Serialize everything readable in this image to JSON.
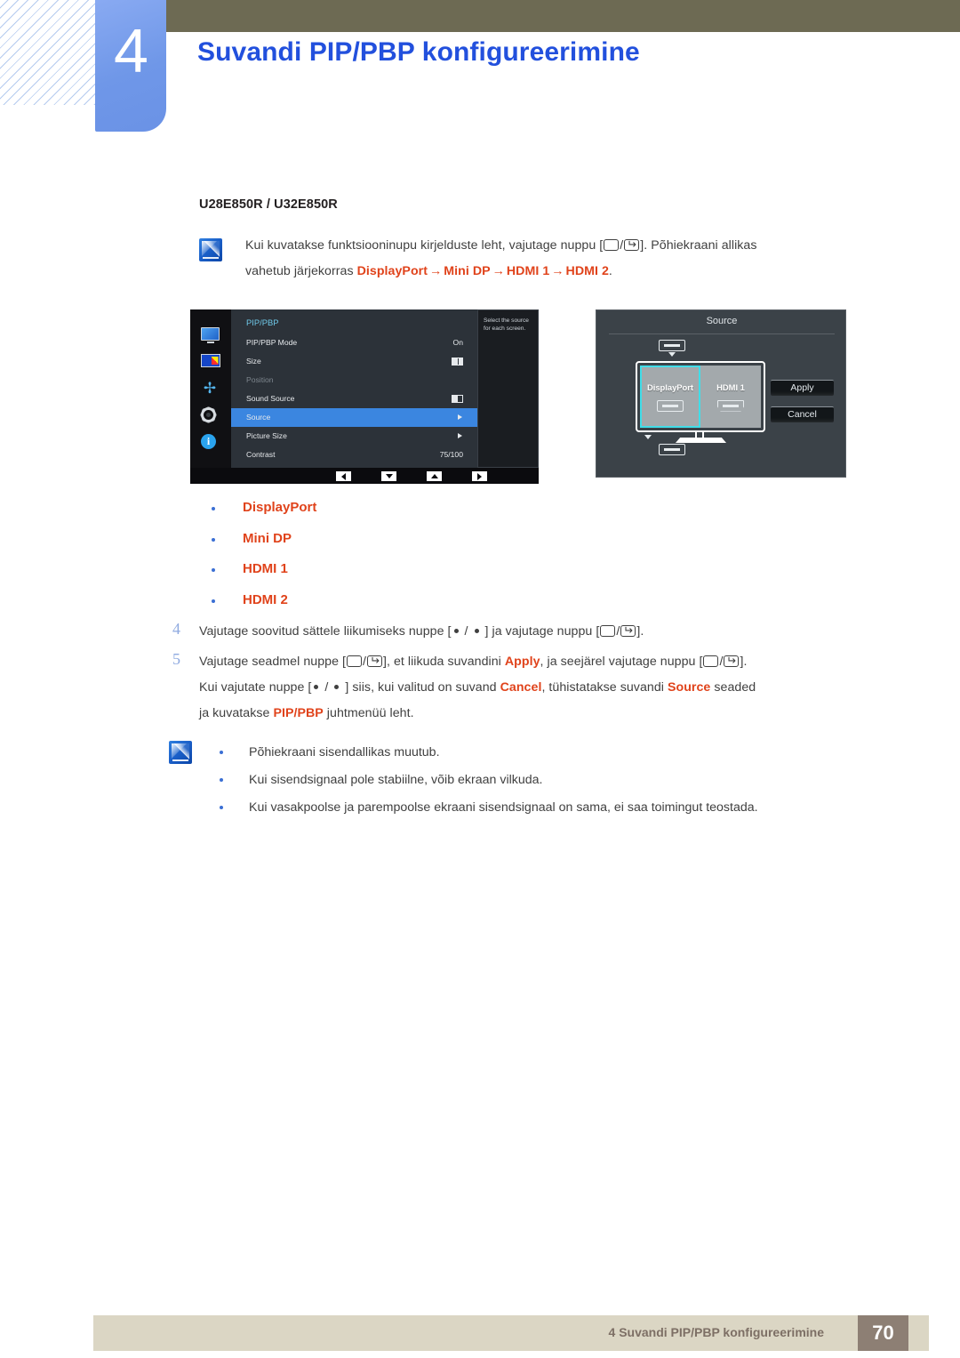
{
  "header": {
    "chapter_number": "4",
    "chapter_title": "Suvandi PIP/PBP konfigureerimine",
    "accent_color": "#2250dd",
    "tab_color": "#6f97e8",
    "olive_color": "#6d6a53"
  },
  "body": {
    "model_heading": "U28E850R / U32E850R",
    "note_intro": {
      "line1_before": "Kui kuvatakse funktsiooninupu kirjelduste leht, vajutage nuppu [",
      "line1_after": "]. Põhiekraani allikas",
      "line2_prefix": "vahetub järjekorras ",
      "line2_items": [
        "DisplayPort",
        "Mini DP",
        "HDMI 1",
        "HDMI 2"
      ],
      "line2_suffix": ".",
      "arrow": "→"
    },
    "source_list": [
      "DisplayPort",
      "Mini DP",
      "HDMI 1",
      "HDMI 2"
    ],
    "steps": [
      {
        "number": "4",
        "parts": [
          "Vajutage soovitud sättele liikumiseks nuppe [",
          " / ",
          " ] ja vajutage nuppu [",
          "]."
        ]
      },
      {
        "number": "5",
        "line1_a": "Vajutage seadmel nuppe [",
        "line1_b": "], et liikuda suvandini ",
        "line1_hl": "Apply",
        "line1_c": ", ja seejärel vajutage nuppu [",
        "line1_d": "].",
        "line2_a": "Kui vajutate nuppe [",
        "line2_b": " ] siis, kui valitud on suvand ",
        "line2_hl1": "Cancel",
        "line2_c": ", tühistatakse suvandi ",
        "line2_hl2": "Source",
        "line2_d": " seaded",
        "line3_a": "ja kuvatakse ",
        "line3_hl": "PIP/PBP",
        "line3_b": " juhtmenüü leht."
      }
    ],
    "notes": [
      "Põhiekraani sisendallikas muutub.",
      "Kui sisendsignaal pole stabiilne, võib ekraan vilkuda.",
      "Kui vasakpoolse ja parempoolse ekraani sisendsignaal on sama, ei saa toimingut teostada."
    ],
    "highlight_color": "#e0431b",
    "bullet_color": "#3b6fd4"
  },
  "osd_menu": {
    "heading": "PIP/PBP",
    "rows": [
      {
        "label": "PIP/PBP Mode",
        "value": "On",
        "control": "text",
        "state": "normal"
      },
      {
        "label": "Size",
        "value": "",
        "control": "split-half",
        "state": "normal"
      },
      {
        "label": "Position",
        "value": "",
        "control": "none",
        "state": "dim"
      },
      {
        "label": "Sound Source",
        "value": "",
        "control": "split-left",
        "state": "normal"
      },
      {
        "label": "Source",
        "value": "",
        "control": "arrow",
        "state": "selected"
      },
      {
        "label": "Picture Size",
        "value": "",
        "control": "arrow",
        "state": "normal"
      },
      {
        "label": "Contrast",
        "value": "75/100",
        "control": "text",
        "state": "normal"
      }
    ],
    "help_text": "Select the source for each screen.",
    "sidebar_icons": [
      "monitor-icon",
      "pip-pbp-icon",
      "position-move-icon",
      "settings-gear-icon",
      "information-icon"
    ],
    "nav_buttons": [
      "left-arrow",
      "down-arrow",
      "up-arrow",
      "right-arrow"
    ],
    "selected_color": "#3b86e0",
    "heading_color": "#6fc8e8"
  },
  "source_dialog": {
    "title": "Source",
    "screens": [
      {
        "label": "DisplayPort",
        "connector": "displayport",
        "selected": true
      },
      {
        "label": "HDMI 1",
        "connector": "hdmi",
        "selected": false
      }
    ],
    "buttons": [
      "Apply",
      "Cancel"
    ],
    "highlight_color": "#41dde8"
  },
  "footer": {
    "text": "4 Suvandi PIP/PBP konfigureerimine",
    "page_number": "70",
    "bar_color": "#dbd6c4",
    "page_box_color": "#8d7f74"
  }
}
